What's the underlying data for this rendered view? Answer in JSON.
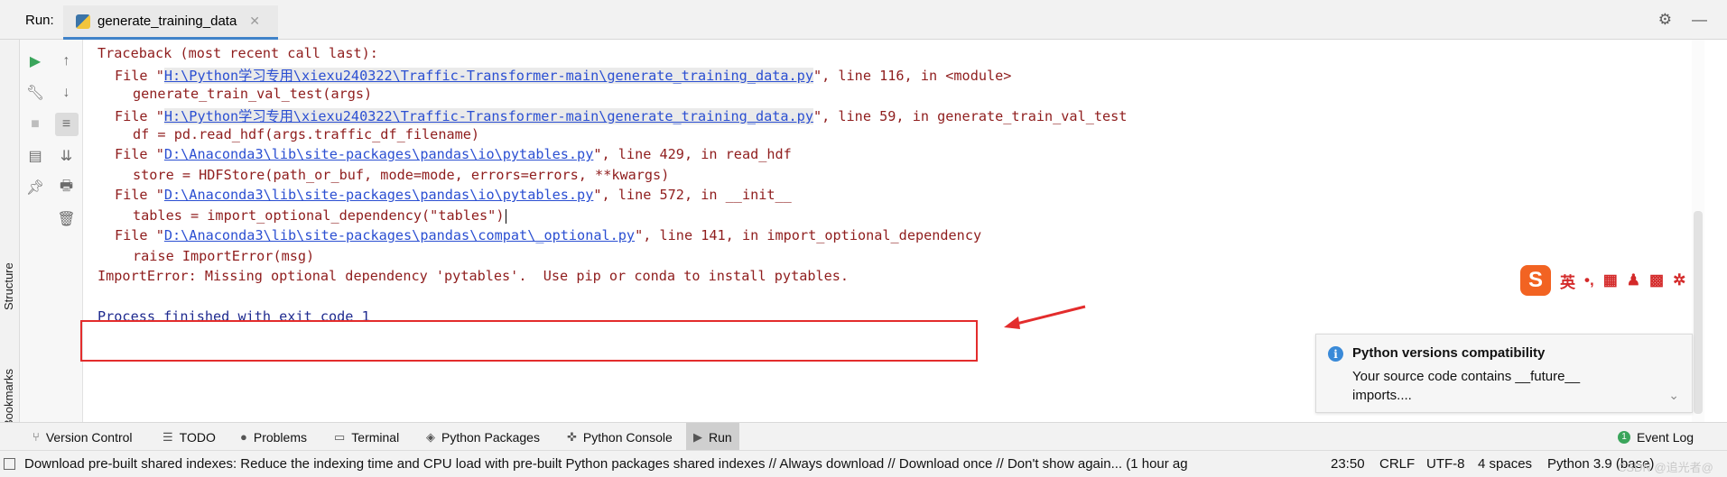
{
  "run_panel": {
    "label": "Run:",
    "tab_title": "generate_training_data"
  },
  "side_stripes": {
    "structure": "Structure",
    "bookmarks": "Bookmarks"
  },
  "console": {
    "lines": [
      {
        "text": "Traceback (most recent call last):"
      },
      {
        "pre": "File \"",
        "link": "H:\\Python学习专用\\xiexu240322\\Traffic-Transformer-main\\generate_training_data.py",
        "post": "\", line 116, in <module>"
      },
      {
        "text": "generate_train_val_test(args)"
      },
      {
        "pre": "File \"",
        "link": "H:\\Python学习专用\\xiexu240322\\Traffic-Transformer-main\\generate_training_data.py",
        "post": "\", line 59, in generate_train_val_test"
      },
      {
        "text": "df = pd.read_hdf(args.traffic_df_filename)"
      },
      {
        "pre": "File \"",
        "link": "D:\\Anaconda3\\lib\\site-packages\\pandas\\io\\pytables.py",
        "post": "\", line 429, in read_hdf"
      },
      {
        "text": "store = HDFStore(path_or_buf, mode=mode, errors=errors, **kwargs)"
      },
      {
        "pre": "File \"",
        "link": "D:\\Anaconda3\\lib\\site-packages\\pandas\\io\\pytables.py",
        "post": "\", line 572, in __init__"
      },
      {
        "text": "tables = import_optional_dependency(\"tables\")"
      },
      {
        "pre": "File \"",
        "link": "D:\\Anaconda3\\lib\\site-packages\\pandas\\compat\\_optional.py",
        "post": "\", line 141, in import_optional_dependency"
      },
      {
        "text": "raise ImportError(msg)"
      },
      {
        "text": "ImportError: Missing optional dependency 'pytables'.  Use pip or conda to install pytables."
      },
      {
        "text": "Process finished with exit code 1"
      }
    ]
  },
  "ime_toolbar": {
    "logo": "S",
    "lang": "英",
    "items": [
      "•,",
      "▦",
      "♟",
      "▩",
      "✲"
    ]
  },
  "notification": {
    "title": "Python versions compatibility",
    "body": "Your source code contains __future__ imports...."
  },
  "tool_windows": [
    {
      "label": "Version Control",
      "icon": "branch-icon"
    },
    {
      "label": "TODO",
      "icon": "list-icon"
    },
    {
      "label": "Problems",
      "icon": "problems-icon"
    },
    {
      "label": "Terminal",
      "icon": "terminal-icon"
    },
    {
      "label": "Python Packages",
      "icon": "packages-icon"
    },
    {
      "label": "Python Console",
      "icon": "python-console-icon"
    },
    {
      "label": "Run",
      "icon": "run-icon",
      "selected": true
    },
    {
      "label": "Event Log",
      "icon": "event-log-icon",
      "badge": "1"
    }
  ],
  "status_bar": {
    "message": "Download pre-built shared indexes: Reduce the indexing time and CPU load with pre-built Python packages shared indexes // Always download // Download once // Don't show again... (1 hour ag",
    "position": "23:50",
    "line_sep": "CRLF",
    "encoding": "UTF-8",
    "indent": "4 spaces",
    "interpreter": "Python 3.9 (base)",
    "watermark": "CSDN @追光者@"
  },
  "colors": {
    "error_text": "#8f1d1d",
    "link": "#2b4fd2",
    "highlight_box": "#e32c2c",
    "accent_tab": "#4083c9",
    "info_blue": "#3a8ad8"
  }
}
